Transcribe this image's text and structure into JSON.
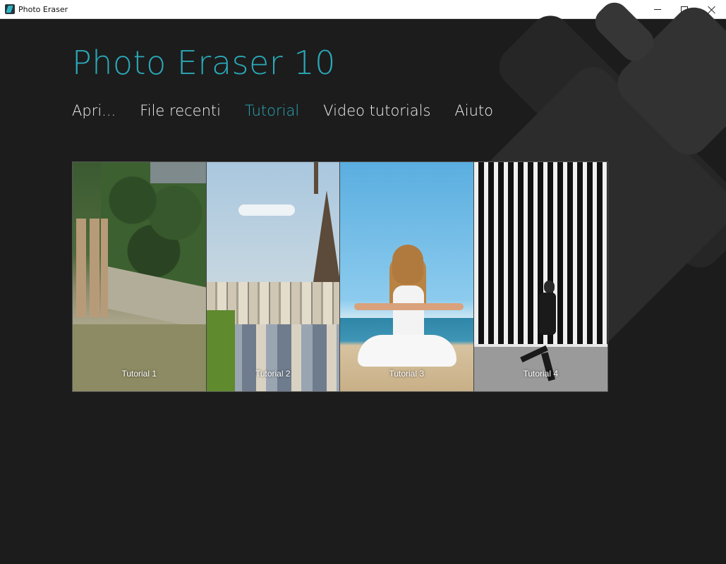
{
  "window": {
    "title": "Photo Eraser",
    "controls": {
      "minimize": "minimize",
      "maximize": "maximize",
      "close": "close"
    }
  },
  "header": {
    "app_title": "Photo Eraser 10"
  },
  "nav": {
    "items": [
      {
        "label": "Apri..."
      },
      {
        "label": "File recenti"
      },
      {
        "label": "Tutorial",
        "active": true
      },
      {
        "label": "Video tutorials"
      },
      {
        "label": "Aiuto"
      }
    ]
  },
  "tutorials": [
    {
      "label": "Tutorial 1"
    },
    {
      "label": "Tutorial 2"
    },
    {
      "label": "Tutorial 3"
    },
    {
      "label": "Tutorial 4"
    }
  ],
  "colors": {
    "accent": "#2aa8b8",
    "background": "#1c1c1c",
    "nav_text": "#f2f2f2"
  }
}
